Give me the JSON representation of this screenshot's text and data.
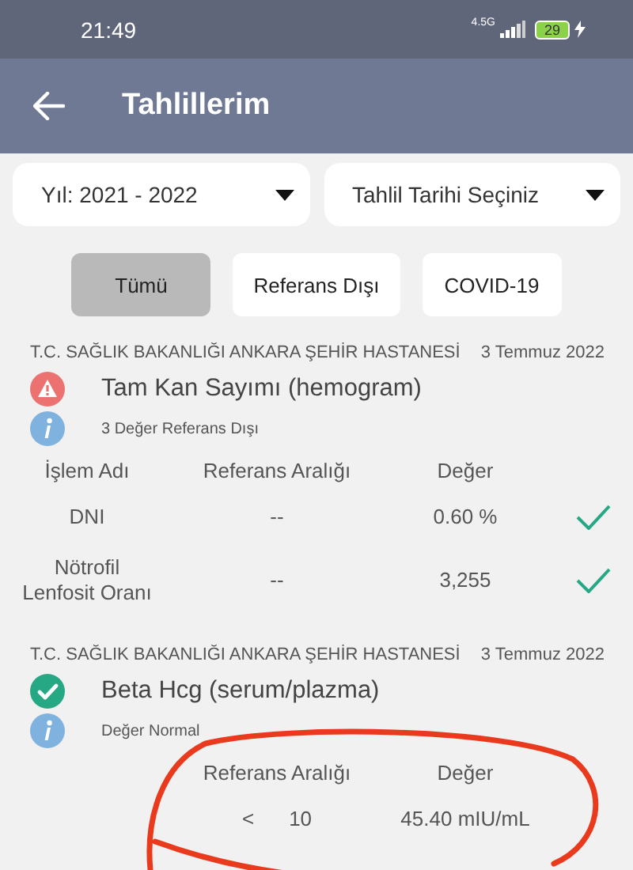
{
  "status_bar": {
    "time": "21:49",
    "network": "4.5G",
    "battery": "29"
  },
  "header": {
    "title": "Tahlillerim"
  },
  "dropdowns": [
    {
      "label": "Yıl: 2021 - 2022"
    },
    {
      "label": "Tahlil Tarihi Seçiniz"
    }
  ],
  "filters": [
    {
      "label": "Tümü",
      "selected": true
    },
    {
      "label": "Referans Dışı",
      "selected": false
    },
    {
      "label": "COVID-19",
      "selected": false
    }
  ],
  "reports": [
    {
      "hospital": "T.C. SAĞLIK BAKANLIĞI ANKARA ŞEHİR HASTANESİ",
      "date": "3 Temmuz 2022",
      "kind": "warning",
      "title": "Tam Kan Sayımı (hemogram)",
      "summary": "3 Değer Referans Dışı",
      "columns": [
        {
          "kind": "name",
          "label": "İşlem Adı"
        },
        {
          "kind": "reference",
          "label": "Referans Aralığı"
        },
        {
          "kind": "value",
          "label": "Değer"
        }
      ],
      "rows": [
        {
          "name": "DNI",
          "reference": [
            "--"
          ],
          "value": "0.60 %",
          "normal": true
        },
        {
          "name": "Nötrofil Lenfosit Oranı",
          "reference": [
            "--"
          ],
          "value": "3,255",
          "normal": true
        }
      ]
    },
    {
      "hospital": "T.C. SAĞLIK BAKANLIĞI ANKARA ŞEHİR HASTANESİ",
      "date": "3 Temmuz 2022",
      "kind": "ok",
      "title": "Beta Hcg (serum/plazma)",
      "summary": "Değer Normal",
      "columns": [
        {
          "kind": "reference",
          "label": "Referans Aralığı"
        },
        {
          "kind": "value",
          "label": "Değer"
        }
      ],
      "rows": [
        {
          "reference": [
            "<",
            "10"
          ],
          "value": "45.40 mIU/mL"
        }
      ]
    }
  ]
}
